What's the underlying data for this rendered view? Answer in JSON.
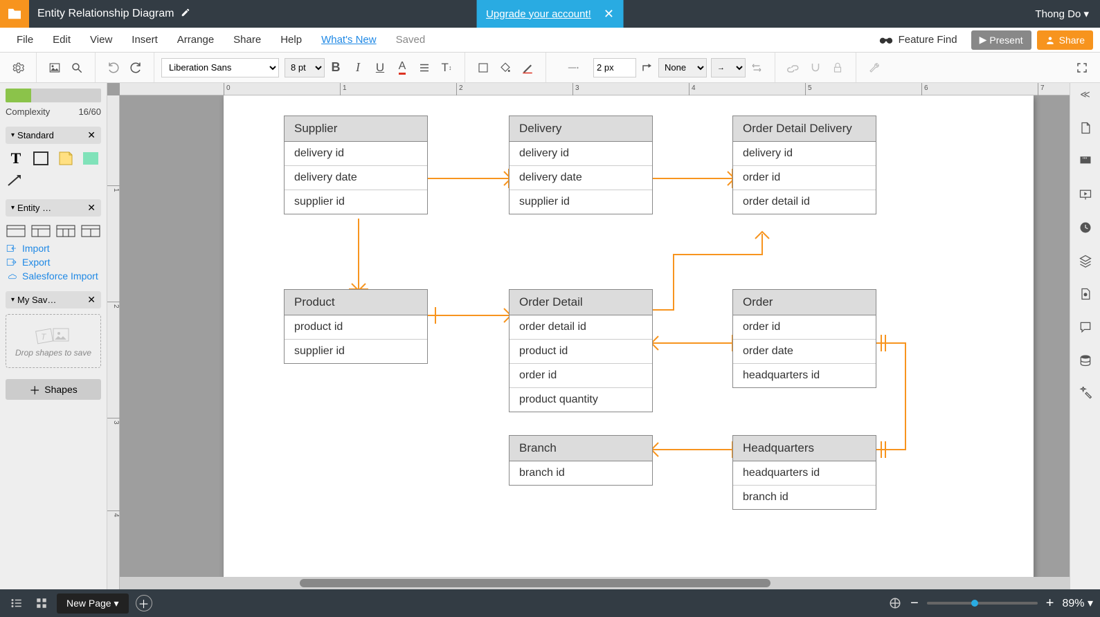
{
  "header": {
    "title": "Entity Relationship Diagram",
    "upgrade_text": "Upgrade your account!",
    "user": "Thong Do"
  },
  "menu": {
    "file": "File",
    "edit": "Edit",
    "view": "View",
    "insert": "Insert",
    "arrange": "Arrange",
    "share": "Share",
    "help": "Help",
    "whatsnew": "What's New",
    "saved": "Saved",
    "feature_find": "Feature Find",
    "present": "Present",
    "share_btn": "Share"
  },
  "toolbar": {
    "font": "Liberation Sans",
    "font_size": "8 pt",
    "line_width": "2 px",
    "line_style_none": "None"
  },
  "left": {
    "complexity_label": "Complexity",
    "complexity_value": "16/60",
    "group_standard": "Standard",
    "group_entity": "Entity …",
    "group_saved": "My Sav…",
    "import": "Import",
    "export": "Export",
    "salesforce": "Salesforce Import",
    "drop_text": "Drop shapes to save",
    "shapes_btn": "Shapes"
  },
  "ruler_h": [
    "0",
    "1",
    "2",
    "3",
    "4",
    "5",
    "6",
    "7"
  ],
  "ruler_v": [
    "1",
    "2",
    "3",
    "4"
  ],
  "entities": {
    "supplier": {
      "title": "Supplier",
      "rows": [
        "delivery id",
        "delivery date",
        "supplier id"
      ]
    },
    "delivery": {
      "title": "Delivery",
      "rows": [
        "delivery id",
        "delivery date",
        "supplier id"
      ]
    },
    "odd": {
      "title": "Order Detail Delivery",
      "rows": [
        "delivery id",
        "order id",
        "order detail id"
      ]
    },
    "product": {
      "title": "Product",
      "rows": [
        "product id",
        "supplier id"
      ]
    },
    "od": {
      "title": "Order Detail",
      "rows": [
        "order detail id",
        "product id",
        "order id",
        "product quantity"
      ]
    },
    "order": {
      "title": "Order",
      "rows": [
        "order id",
        "order date",
        "headquarters id"
      ]
    },
    "branch": {
      "title": "Branch",
      "rows": [
        "branch id"
      ]
    },
    "hq": {
      "title": "Headquarters",
      "rows": [
        "headquarters id",
        "branch id"
      ]
    }
  },
  "footer": {
    "page_tab": "New Page",
    "zoom": "89%"
  },
  "chart_data": {
    "type": "er-diagram",
    "entities": [
      {
        "name": "Supplier",
        "attributes": [
          "delivery id",
          "delivery date",
          "supplier id"
        ]
      },
      {
        "name": "Delivery",
        "attributes": [
          "delivery id",
          "delivery date",
          "supplier id"
        ]
      },
      {
        "name": "Order Detail Delivery",
        "attributes": [
          "delivery id",
          "order id",
          "order detail id"
        ]
      },
      {
        "name": "Product",
        "attributes": [
          "product id",
          "supplier id"
        ]
      },
      {
        "name": "Order Detail",
        "attributes": [
          "order detail id",
          "product id",
          "order id",
          "product quantity"
        ]
      },
      {
        "name": "Order",
        "attributes": [
          "order id",
          "order date",
          "headquarters id"
        ]
      },
      {
        "name": "Branch",
        "attributes": [
          "branch id"
        ]
      },
      {
        "name": "Headquarters",
        "attributes": [
          "headquarters id",
          "branch id"
        ]
      }
    ],
    "relationships": [
      {
        "from": "Supplier",
        "to": "Delivery",
        "cardinality": "one-to-many"
      },
      {
        "from": "Delivery",
        "to": "Order Detail Delivery",
        "cardinality": "one-to-many"
      },
      {
        "from": "Supplier",
        "to": "Product",
        "cardinality": "one-to-many"
      },
      {
        "from": "Product",
        "to": "Order Detail",
        "cardinality": "one-to-many"
      },
      {
        "from": "Order Detail",
        "to": "Order Detail Delivery",
        "cardinality": "many-to-one"
      },
      {
        "from": "Order Detail",
        "to": "Order",
        "cardinality": "many-to-one"
      },
      {
        "from": "Branch",
        "to": "Headquarters",
        "cardinality": "many-to-one"
      },
      {
        "from": "Order",
        "to": "Headquarters",
        "cardinality": "one-to-many"
      }
    ]
  }
}
